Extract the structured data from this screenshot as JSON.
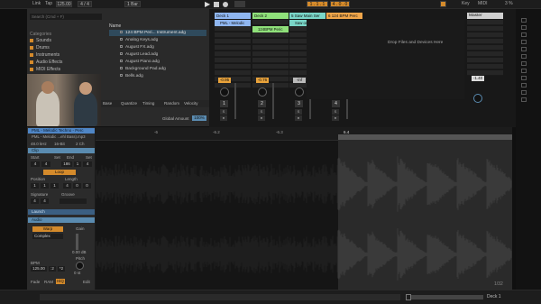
{
  "topbar": {
    "link": "Link",
    "tap": "Tap",
    "bpm": "125.00",
    "meter": "4 / 4",
    "quant": "1 Bar",
    "position": "1 . 1 . 1",
    "pos2": "4 . 0 . 0",
    "key": "Key",
    "midi": "MIDI",
    "cpu": "3 %"
  },
  "browser": {
    "search_placeholder": "Search (Cmd + F)",
    "categories_title": "Categories",
    "categories": [
      "Sounds",
      "Drums",
      "Instruments",
      "Audio Effects",
      "MIDI Effects"
    ],
    "name_header": "Name",
    "files": [
      "124 BPM Peri... Instrument.adg",
      "Analog Keys.adg",
      "August FX.adg",
      "August Lead.adg",
      "August Piano.adg",
      "Background Pad.adg",
      "Bells.adg"
    ],
    "groove_cols": [
      "Base",
      "Quantize",
      "Timing",
      "Random",
      "Velocity"
    ],
    "global_amount_label": "Global Amount",
    "global_amount_value": "100%"
  },
  "tracks": [
    {
      "name": "Deck 1",
      "color": "#8fb6f0",
      "clip": "PML - Melodic",
      "vol": "-0.95",
      "num": "1",
      "volcolor": "#e9a33b"
    },
    {
      "name": "Deck 2",
      "color": "#8fe07a",
      "clip": "124BPM Peric",
      "vol": "-0.76",
      "num": "2",
      "volcolor": "#e9a33b"
    },
    {
      "name": "5 Saw Main Ser",
      "color": "#7ad6c8",
      "clip": "Saw one",
      "vol": "-inf",
      "num": "3",
      "volcolor": "#bbbbbb"
    },
    {
      "name": "6 124 BPM Perc",
      "color": "#f0a64a",
      "clip": "Chorus Saw",
      "vol": "-inf",
      "num": "4",
      "volcolor": "#bbbbbb"
    }
  ],
  "drop_text": "Drop Files and Devices Here",
  "master": {
    "name": "Master",
    "vol": "-1.40"
  },
  "ruler": [
    "1",
    "2",
    "3",
    "4",
    "5"
  ],
  "ruler_labels": [
    "-6",
    "-6.2",
    "-6.3",
    "6.4"
  ],
  "clip": {
    "title": "PML - Melodic Techno - Perc",
    "file": "PML - Melodic ...ehl Bass).mp3",
    "info": [
      "48.0 kHz",
      "16-Bit",
      "2 Ch"
    ],
    "clip_hdr": "Clip",
    "start_lbl": "Start",
    "set_lbl": "Set",
    "end_lbl": "End",
    "start_val": "4",
    "start_val2": "4",
    "end_val": "186",
    "end_val2": "1",
    "end_val3": "4",
    "loop_lbl": "Loop",
    "position_lbl": "Position",
    "length_lbl": "Length",
    "pos_vals": [
      "1",
      "1",
      "1"
    ],
    "len_vals": [
      "4",
      "0",
      "0"
    ],
    "signature_lbl": "Signature",
    "groove_lbl": "Groove",
    "sig_top": "4",
    "sig_bot": "4",
    "launch_hdr": "Launch",
    "audio_hdr": "Audio",
    "warp": "Warp",
    "complex": "Complex",
    "gain_lbl": "Gain",
    "gain_val": "0.00 dB",
    "pitch_lbl": "Pitch",
    "pitch_val": "0 st",
    "bpm_lbl": "BPM",
    "bpm_val": "125.00",
    "half": ":2",
    "dbl": "*2",
    "fade": "Fade",
    "ram": "RAM",
    "hiq": "HiQ",
    "edit": "Edit"
  },
  "loop_counter": "1/32",
  "bottom": {
    "track_name": "Deck 1"
  }
}
